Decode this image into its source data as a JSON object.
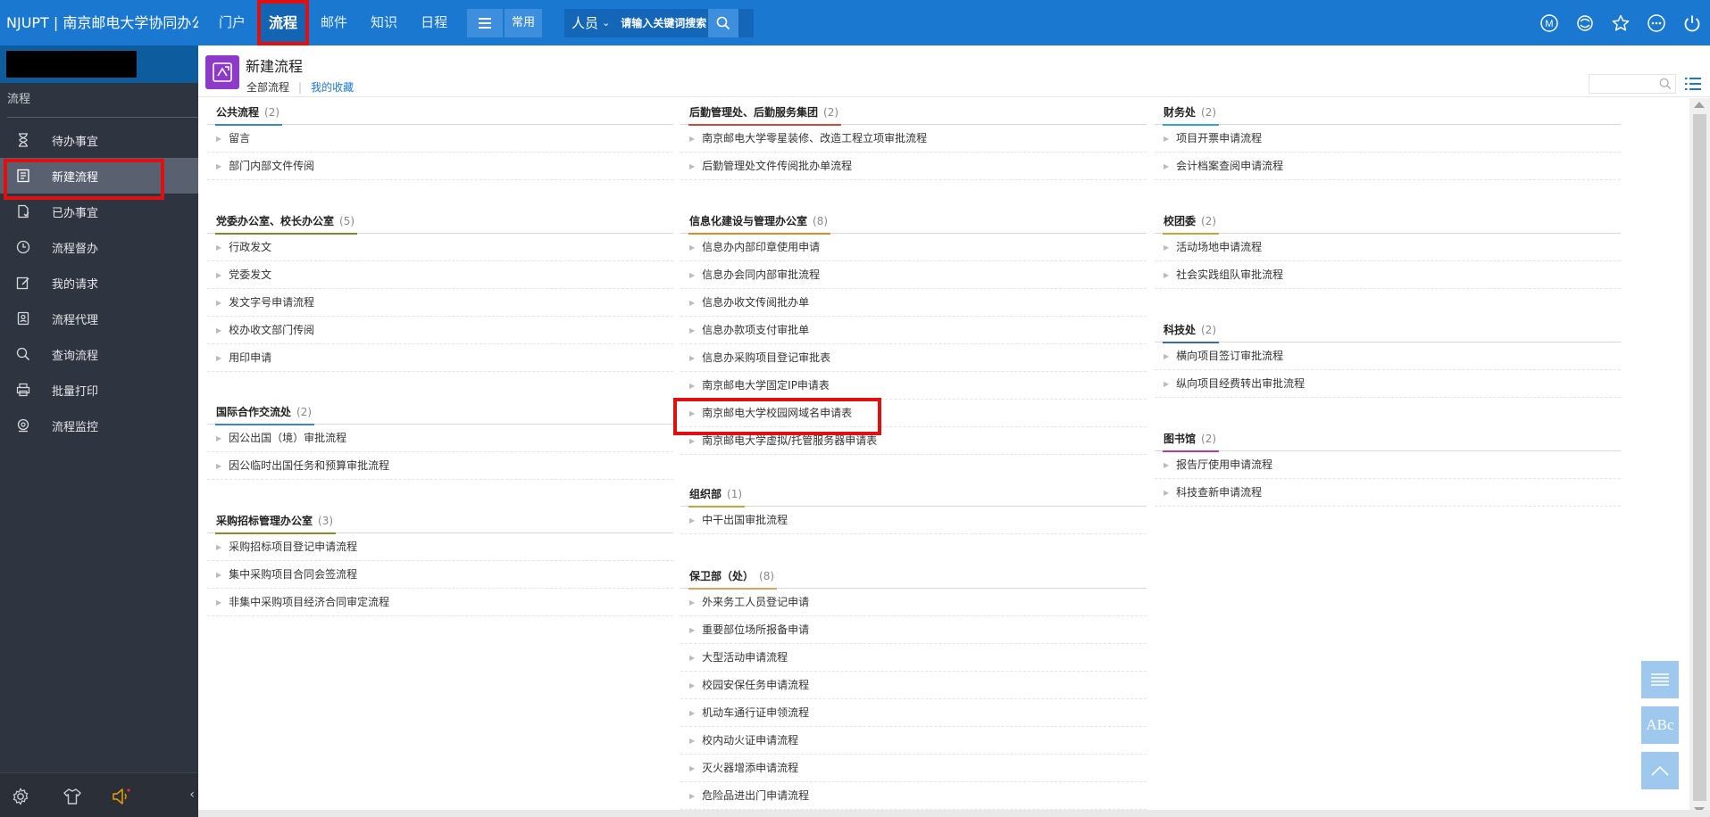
{
  "topbar": {
    "brand": "NJUPT | 南京邮电大学协同办公",
    "nav": [
      {
        "label": "门户"
      },
      {
        "label": "流程",
        "active": true
      },
      {
        "label": "邮件"
      },
      {
        "label": "知识"
      },
      {
        "label": "日程"
      }
    ],
    "common_label": "常用",
    "search_type": "人员",
    "search_placeholder": "请输入关键词搜索",
    "avatar_letter": "M",
    "icons": [
      "avatar-icon",
      "refresh-icon",
      "star-icon",
      "more-icon",
      "power-icon"
    ],
    "accent": "#1a78d0"
  },
  "sidebar": {
    "section_title": "流程",
    "items": [
      {
        "label": "待办事宜",
        "icon": "hourglass-icon"
      },
      {
        "label": "新建流程",
        "icon": "new-form-icon",
        "active": true
      },
      {
        "label": "已办事宜",
        "icon": "done-doc-icon"
      },
      {
        "label": "流程督办",
        "icon": "clock-icon"
      },
      {
        "label": "我的请求",
        "icon": "edit-icon"
      },
      {
        "label": "流程代理",
        "icon": "agent-icon"
      },
      {
        "label": "查询流程",
        "icon": "search-icon"
      },
      {
        "label": "批量打印",
        "icon": "printer-icon"
      },
      {
        "label": "流程监控",
        "icon": "monitor-icon"
      }
    ],
    "bottom_icons": [
      "settings-icon",
      "shirt-icon",
      "speaker-icon",
      "collapse-icon"
    ]
  },
  "main": {
    "title": "新建流程",
    "tabs": [
      {
        "label": "全部流程"
      },
      {
        "label": "我的收藏"
      }
    ],
    "icon_color": "#8e3ac9"
  },
  "groups": {
    "g1": {
      "name": "公共流程",
      "count": "(2)",
      "accent": "#3a87c8",
      "items": [
        "留言",
        "部门内部文件传阅"
      ]
    },
    "g2": {
      "name": "党委办公室、校长办公室",
      "count": "(5)",
      "accent": "#7a8b2c",
      "items": [
        "行政发文",
        "党委发文",
        "发文字号申请流程",
        "校办收文部门传阅",
        "用印申请"
      ]
    },
    "g3": {
      "name": "国际合作交流处",
      "count": "(2)",
      "accent": "#3a87c8",
      "items": [
        "因公出国（境）审批流程",
        "因公临时出国任务和预算审批流程"
      ]
    },
    "g4": {
      "name": "采购招标管理办公室",
      "count": "(3)",
      "accent": "#8b8b2c",
      "items": [
        "采购招标项目登记申请流程",
        "集中采购项目合同会签流程",
        "非集中采购项目经济合同审定流程"
      ]
    },
    "g5": {
      "name": "后勤管理处、后勤服务集团",
      "count": "(2)",
      "accent": "#d24a3a",
      "items": [
        "南京邮电大学零星装修、改造工程立项审批流程",
        "后勤管理处文件传阅批办单流程"
      ]
    },
    "g6": {
      "name": "信息化建设与管理办公室",
      "count": "(8)",
      "accent": "#e08a2a",
      "items": [
        "信息办内部印章使用申请",
        "信息办会同内部审批流程",
        "信息办收文传阅批办单",
        "信息办款项支付审批单",
        "信息办采购项目登记审批表",
        "南京邮电大学固定IP申请表",
        "南京邮电大学校园网域名申请表",
        "南京邮电大学虚拟/托管服务器申请表"
      ]
    },
    "g7": {
      "name": "组织部",
      "count": "(1)",
      "accent": "#c8a23a",
      "items": [
        "中干出国审批流程"
      ]
    },
    "g8": {
      "name": "保卫部（处）",
      "count": "(8)",
      "accent": "#e0a060",
      "items": [
        "外来务工人员登记申请",
        "重要部位场所报备申请",
        "大型活动申请流程",
        "校园安保任务申请流程",
        "机动车通行证申领流程",
        "校内动火证申请流程",
        "灭火器增添申请流程",
        "危险品进出门申请流程"
      ]
    },
    "g9": {
      "name": "财务处",
      "count": "(2)",
      "accent": "#3aa0d8",
      "items": [
        "项目开票申请流程",
        "会计档案查阅申请流程"
      ]
    },
    "g10": {
      "name": "校团委",
      "count": "(2)",
      "accent": "#c8a23a",
      "items": [
        "活动场地申请流程",
        "社会实践组队审批流程"
      ]
    },
    "g11": {
      "name": "科技处",
      "count": "(2)",
      "accent": "#3a6ab8",
      "items": [
        "横向项目签订审批流程",
        "纵向项目经费转出审批流程"
      ]
    },
    "g12": {
      "name": "图书馆",
      "count": "(2)",
      "accent": "#b83a9a",
      "items": [
        "报告厅使用申请流程",
        "科技查新申请流程"
      ]
    }
  },
  "highlight_item": "南京邮电大学校园网域名申请表",
  "float_buttons": [
    "list-view-icon",
    "font-size-icon",
    "back-to-top-icon"
  ],
  "font_button_label": "ABc"
}
